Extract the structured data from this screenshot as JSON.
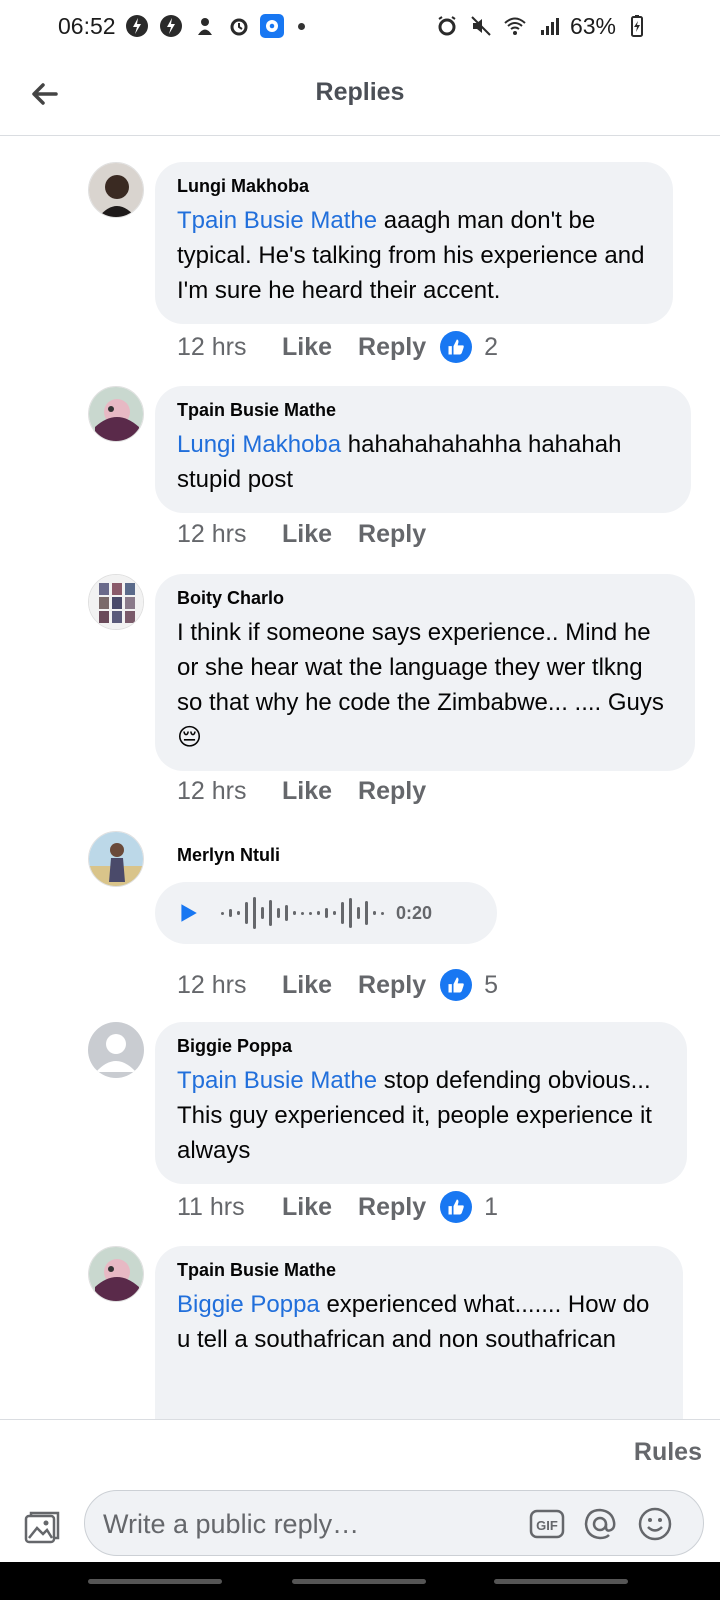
{
  "status_bar": {
    "time": "06:52",
    "battery": "63%"
  },
  "header": {
    "title": "Replies"
  },
  "comments": [
    {
      "author": "Lungi Makhoba",
      "mention": "Tpain Busie Mathe",
      "text": " aaagh man don't be typical. He's talking from his experience and I'm sure he heard their accent.",
      "time": "12 hrs",
      "like_label": "Like",
      "reply_label": "Reply",
      "reactions": "2"
    },
    {
      "author": "Tpain Busie Mathe",
      "mention": "Lungi Makhoba",
      "text": " hahahahahahha hahahah stupid post",
      "time": "12 hrs",
      "like_label": "Like",
      "reply_label": "Reply"
    },
    {
      "author": "Boity Charlo",
      "text": "I think if someone says experience.. Mind he or she hear wat the language they wer tlkng so that why  he code the Zimbabwe... .... Guys 😔",
      "time": "12 hrs",
      "like_label": "Like",
      "reply_label": "Reply"
    },
    {
      "author": "Merlyn Ntuli",
      "voice_duration": "0:20",
      "time": "12 hrs",
      "like_label": "Like",
      "reply_label": "Reply",
      "reactions": "5"
    },
    {
      "author": "Biggie Poppa",
      "mention": "Tpain Busie Mathe",
      "text": " stop defending obvious... This guy experienced it, people experience it always",
      "time": "11 hrs",
      "like_label": "Like",
      "reply_label": "Reply",
      "reactions": "1"
    },
    {
      "author": "Tpain Busie Mathe",
      "mention": "Biggie Poppa",
      "text": " experienced what....... How do u tell a southafrican and non southafrican"
    }
  ],
  "composer": {
    "rules_label": "Rules",
    "placeholder": "Write a public reply…",
    "gif_label": "GIF"
  },
  "colors": {
    "mention": "#216fdb",
    "like_blue": "#1877f2",
    "bubble": "#f0f2f5"
  }
}
